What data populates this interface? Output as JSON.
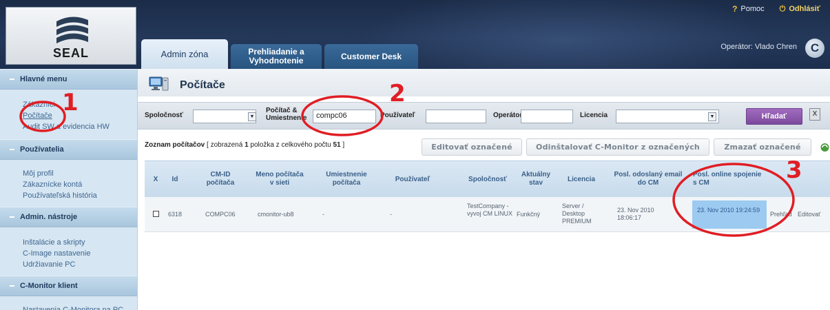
{
  "header": {
    "logo_text": "SEAL",
    "help_label": "Pomoc",
    "help_glyph": "?",
    "logout_label": "Odhlásiť",
    "operator_text": "Operátor: Vlado Chren",
    "c_logo": "C",
    "tabs": [
      {
        "label": "Admin zóna",
        "active": true
      },
      {
        "label": "Prehliadanie a Vyhodnotenie",
        "active": false
      },
      {
        "label": "Customer Desk",
        "active": false
      }
    ]
  },
  "sidebar": {
    "sections": [
      {
        "title": "Hlavné menu",
        "items": [
          "Zákazníci",
          "Počítače",
          "Audit SW a evidencia HW"
        ]
      },
      {
        "title": "Používatelia",
        "items": [
          "Môj profil",
          "Zákaznícke kontá",
          "Používateľská história"
        ]
      },
      {
        "title": "Admin. nástroje",
        "items": [
          "Inštalácie a skripty",
          "C-Image nastavenie",
          "Udržiavanie PC"
        ]
      },
      {
        "title": "C-Monitor klient",
        "items": [
          "Nastavenia C-Monitora na PC"
        ]
      }
    ]
  },
  "page": {
    "title": "Počítače",
    "filters": {
      "company_label": "Spoločnosť",
      "computer_label": "Počítač & Umiestnenie",
      "computer_value": "compc06",
      "user_label": "Používateľ",
      "operator_label": "Operátor",
      "license_label": "Licencia",
      "search_button": "Hľadať",
      "clear_glyph": "X"
    },
    "list": {
      "summary_title": "Zoznam počítačov",
      "summary_open": "[ zobrazená",
      "summary_count": "1",
      "summary_mid": "položka z celkového počtu",
      "summary_total": "51",
      "summary_close": "]",
      "edit_button": "Editovať označené",
      "uninstall_button": "Odinštalovať C-Monitor z označených",
      "delete_button": "Zmazať označené"
    },
    "table": {
      "columns": [
        "X",
        "Id",
        "CM-ID počítača",
        "Meno počítača v sieti",
        "Umiestnenie počítača",
        "Používateľ",
        "Spoločnosť",
        "Aktuálny stav",
        "Licencia",
        "Posl. odoslaný email do CM",
        "Posl. online spojenie s CM"
      ],
      "rows": [
        {
          "id": "6318",
          "cm_id": "COMPC06",
          "net_name": "cmonitor-ub8",
          "location": "-",
          "user": "-",
          "company": "TestCompany - vyvoj CM LINUX",
          "status": "Funkčný",
          "license": "Server / Desktop PREMIUM",
          "last_email": "23. Nov 2010 18:06:17",
          "last_online": "23. Nov 2010 19:24:59",
          "link_overview": "Prehľad",
          "link_edit": "Editovať"
        }
      ]
    }
  },
  "annotations": {
    "marks": [
      "1",
      "2",
      "3"
    ],
    "color": "#e01e24"
  }
}
